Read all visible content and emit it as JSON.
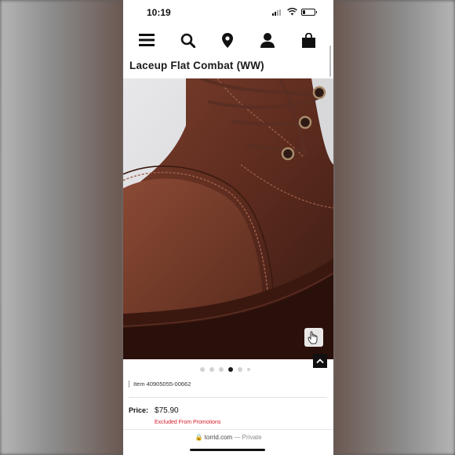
{
  "status": {
    "time": "10:19",
    "battery_level": 0.2
  },
  "nav": {
    "icons": [
      "menu-icon",
      "search-icon",
      "location-pin-icon",
      "account-icon",
      "shopping-bag-icon"
    ]
  },
  "product": {
    "title": "Laceup Flat Combat (WW)",
    "item_number": "Item 40905055-00662",
    "price_label": "Price:",
    "price_value": "$75.90",
    "promo_note": "Excluded From Promotions",
    "image_count": 6,
    "active_image_index": 3
  },
  "browser": {
    "domain": "torrid.com",
    "mode": "— Private"
  },
  "colors": {
    "promo_red": "#d11a2a",
    "boot_brown": "#5a2e22"
  }
}
